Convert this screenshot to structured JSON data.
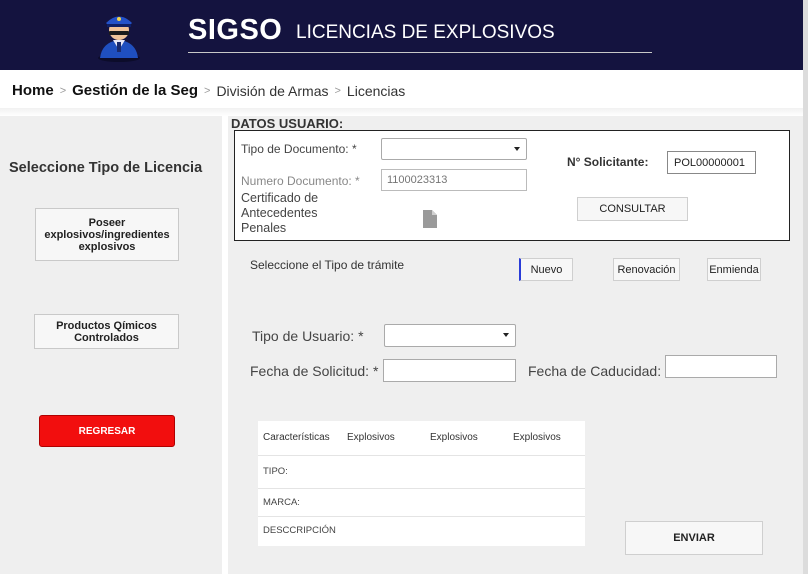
{
  "header": {
    "app_name": "SIGSO",
    "subtitle": "LICENCIAS DE EXPLOSIVOS",
    "logo_icon": "police-officer-icon",
    "background_color": "#14133f"
  },
  "breadcrumb": {
    "items": [
      "Home",
      "Gestión de la Seg",
      "División de Armas",
      "Licencias"
    ],
    "separator": ">"
  },
  "left_panel": {
    "title": "Seleccione Tipo de Licencia",
    "buttons": {
      "poseer": "Poseer explosivos/ingredientes explosivos",
      "quimicos": "Productos Qímicos Controlados",
      "regresar": "REGRESAR"
    },
    "regresar_color": "#f20e0e"
  },
  "datos_usuario": {
    "title": "DATOS USUARIO:",
    "tipo_documento_label": "Tipo de Documento: *",
    "tipo_documento_value": "",
    "numero_documento_label": "Numero Documento: *",
    "numero_documento_placeholder": "1100023313",
    "certificado_label": "Certificado de Antecedentes Penales",
    "certificado_icon": "document-icon",
    "solicitante_label": "N° Solicitante:",
    "solicitante_value": "POL00000001",
    "consultar_label": "CONSULTAR"
  },
  "tramite": {
    "label": "Seleccione el Tipo de trámite",
    "options": [
      "Nuevo",
      "Renovación",
      "Enmienda"
    ],
    "selected": "Nuevo"
  },
  "form": {
    "tipo_usuario_label": "Tipo de Usuario: *",
    "tipo_usuario_value": "",
    "fecha_solicitud_label": "Fecha de Solicitud: *",
    "fecha_solicitud_value": "",
    "fecha_caducidad_label": "Fecha de Caducidad: *",
    "fecha_caducidad_value": ""
  },
  "table": {
    "headers": [
      "Características",
      "Explosivos",
      "Explosivos",
      "Explosivos"
    ],
    "rows": [
      "TIPO:",
      "MARCA:",
      "DESCCRIPCIÓN"
    ]
  },
  "enviar_label": "ENVIAR"
}
